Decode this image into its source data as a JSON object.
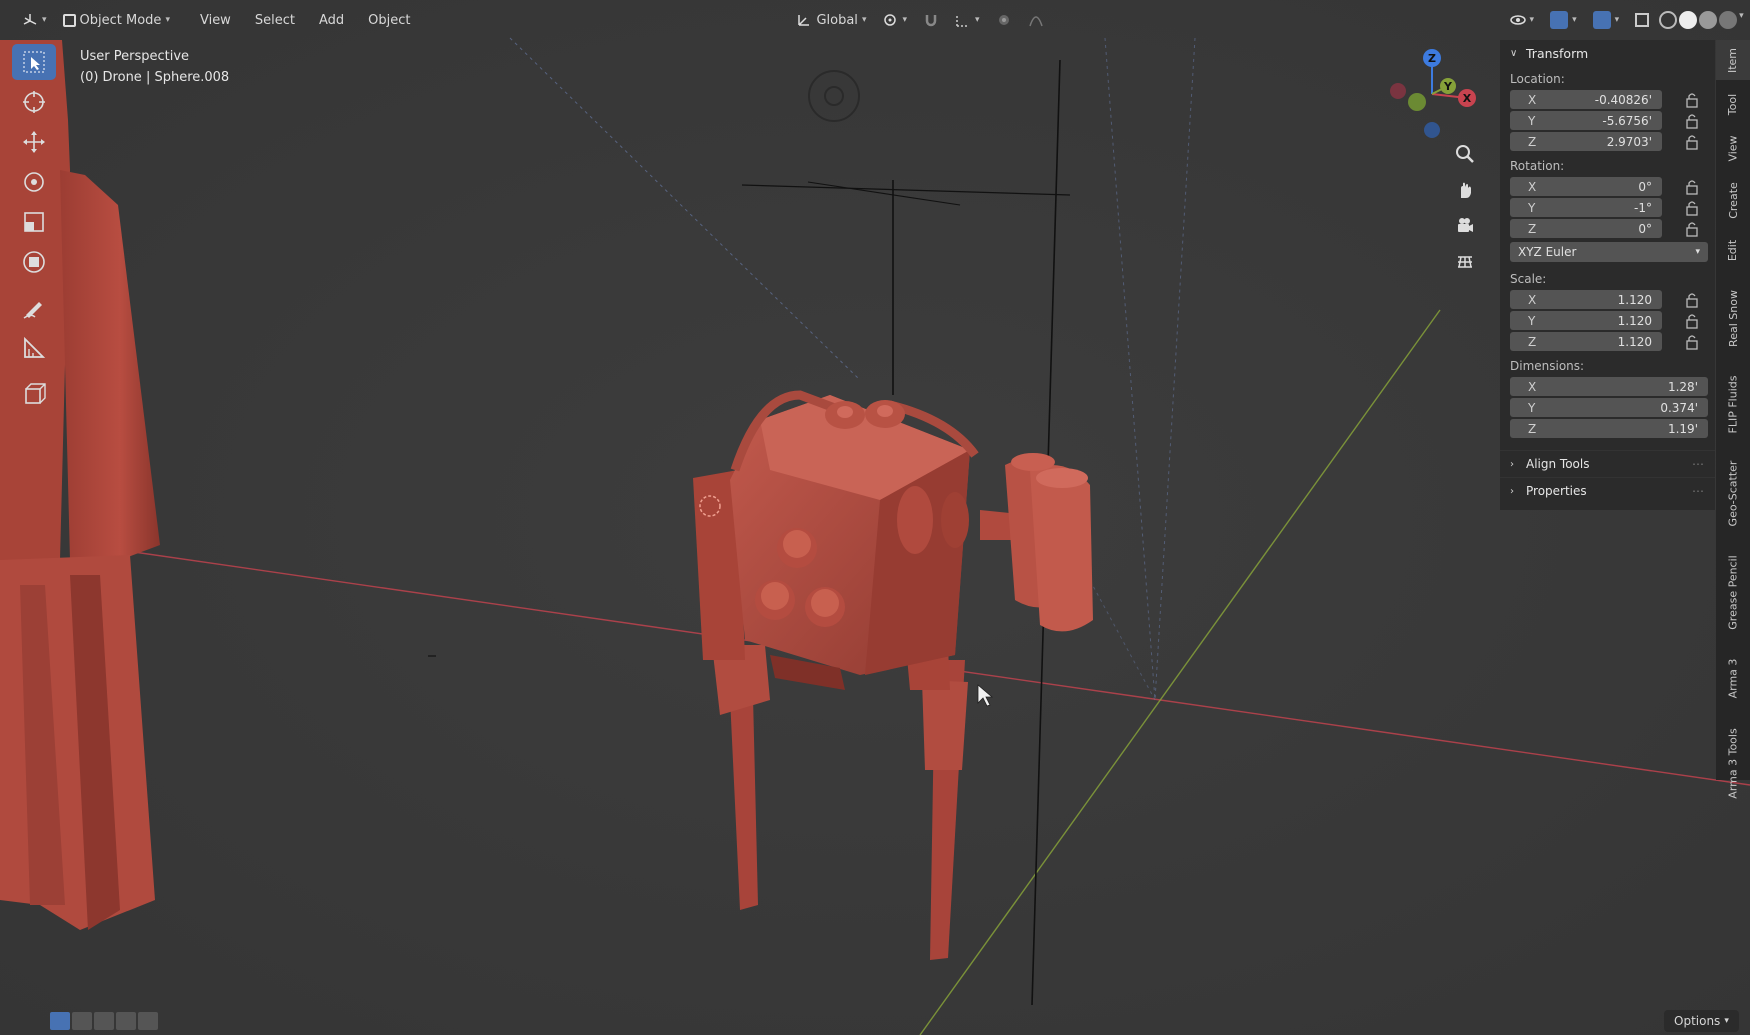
{
  "header": {
    "mode_label": "Object Mode",
    "menus": [
      "View",
      "Select",
      "Add",
      "Object"
    ],
    "transform_orientation": "Global"
  },
  "viewport": {
    "view_name": "User Perspective",
    "object_info": "(0) Drone | Sphere.008"
  },
  "colors": {
    "accent": "#4772b3",
    "model": "#b3483d",
    "x_axis": "#c8434f",
    "y_axis": "#86a139",
    "z_axis": "#3d7be0"
  },
  "npanel": {
    "transform_title": "Transform",
    "location_label": "Location:",
    "location": [
      {
        "axis": "X",
        "value": "-0.40826'"
      },
      {
        "axis": "Y",
        "value": "-5.6756'"
      },
      {
        "axis": "Z",
        "value": "2.9703'"
      }
    ],
    "rotation_label": "Rotation:",
    "rotation": [
      {
        "axis": "X",
        "value": "0°"
      },
      {
        "axis": "Y",
        "value": "-1°"
      },
      {
        "axis": "Z",
        "value": "0°"
      }
    ],
    "rotation_mode": "XYZ Euler",
    "scale_label": "Scale:",
    "scale": [
      {
        "axis": "X",
        "value": "1.120"
      },
      {
        "axis": "Y",
        "value": "1.120"
      },
      {
        "axis": "Z",
        "value": "1.120"
      }
    ],
    "dimensions_label": "Dimensions:",
    "dimensions": [
      {
        "axis": "X",
        "value": "1.28'"
      },
      {
        "axis": "Y",
        "value": "0.374'"
      },
      {
        "axis": "Z",
        "value": "1.19'"
      }
    ],
    "align_tools": "Align Tools",
    "properties": "Properties"
  },
  "tabs": [
    "Item",
    "Tool",
    "View",
    "Create",
    "Edit",
    "Real Snow",
    "FLIP Fluids",
    "Geo-Scatter",
    "Grease Pencil",
    "Arma 3",
    "Arma 3 Tools"
  ],
  "gizmo": {
    "x": "X",
    "y": "Y",
    "z": "Z"
  },
  "bottom": {
    "options_label": "Options"
  }
}
